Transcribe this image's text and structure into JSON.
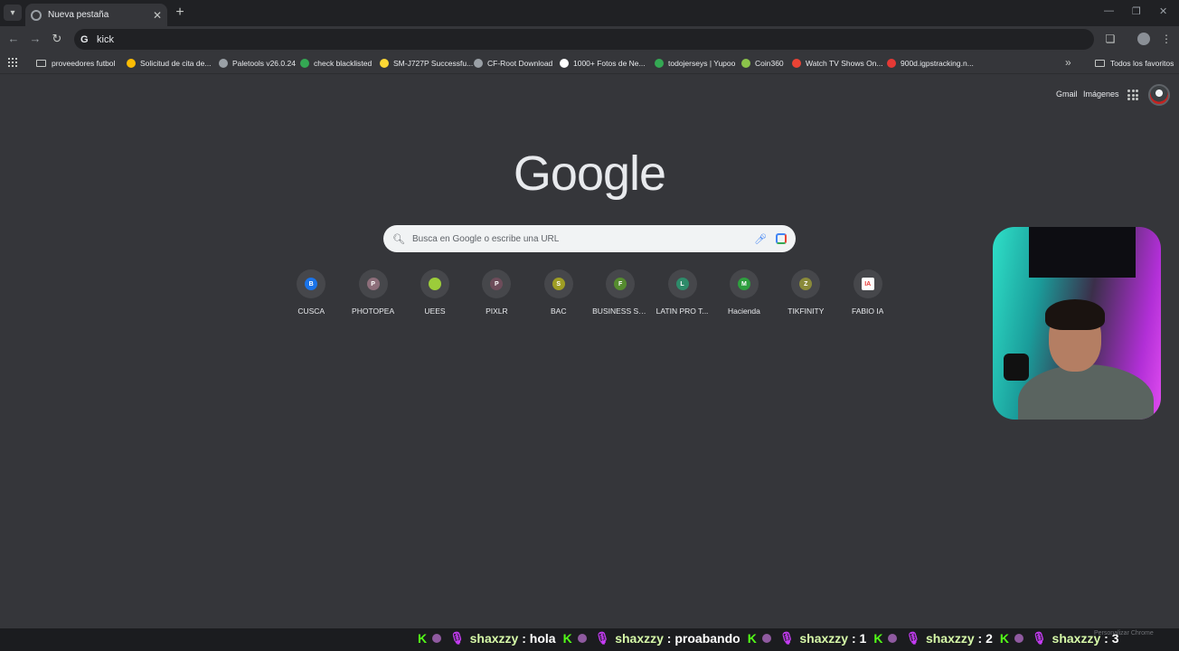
{
  "browser": {
    "tab_title": "Nueva pestaña",
    "omnibox_value": "kick",
    "colors": {
      "frame": "#202124",
      "toolbar": "#35363a",
      "page_bg": "#35363a"
    }
  },
  "bookmarks": [
    {
      "label": "proveedores futbol",
      "icon": "folder-icon",
      "color": ""
    },
    {
      "label": "Solicitud de cita de...",
      "icon": "bookmark-favicon",
      "color": "#fbbc04"
    },
    {
      "label": "Paletools v26.0.24",
      "icon": "globe-icon",
      "color": "#9aa0a6"
    },
    {
      "label": "check blacklisted",
      "icon": "bookmark-favicon",
      "color": "#34a853"
    },
    {
      "label": "SM-J727P Successfu...",
      "icon": "smiley-icon",
      "color": "#fdd835"
    },
    {
      "label": "CF-Root Download",
      "icon": "globe-icon",
      "color": "#9aa0a6"
    },
    {
      "label": "1000+ Fotos de Ne...",
      "icon": "bookmark-favicon",
      "color": "#ffffff"
    },
    {
      "label": "todojerseys | Yupoo",
      "icon": "bookmark-favicon",
      "color": "#34a853"
    },
    {
      "label": "Coin360",
      "icon": "bookmark-favicon",
      "color": "#8bc34a"
    },
    {
      "label": "Watch TV Shows On...",
      "icon": "bookmark-favicon",
      "color": "#ea4335"
    },
    {
      "label": "900d.igpstracking.n...",
      "icon": "bookmark-favicon",
      "color": "#e53935"
    }
  ],
  "bookmarks_all": "Todos los favoritos",
  "ntp": {
    "gmail": "Gmail",
    "images": "Imágenes",
    "logo": "Google",
    "search_placeholder": "Busca en Google o escribe una URL",
    "shortcuts": [
      {
        "label": "CUSCA",
        "letter": "B",
        "color": "#1a73e8"
      },
      {
        "label": "PHOTOPEA",
        "letter": "P",
        "color": "#8d6e7a"
      },
      {
        "label": "UEES",
        "letter": "",
        "color": "#9ccc3a"
      },
      {
        "label": "PIXLR",
        "letter": "P",
        "color": "#6d4c5a"
      },
      {
        "label": "BAC",
        "letter": "S",
        "color": "#9e9d24"
      },
      {
        "label": "BUSINESS SU...",
        "letter": "F",
        "color": "#558b2f"
      },
      {
        "label": "LATIN PRO T...",
        "letter": "L",
        "color": "#2e8b6a"
      },
      {
        "label": "Hacienda",
        "letter": "M",
        "color": "#2e9e3e"
      },
      {
        "label": "TIKFINITY",
        "letter": "Z",
        "color": "#8a8a3a"
      },
      {
        "label": "FABIO IA",
        "letter": "IA",
        "color": "#e53935"
      }
    ]
  },
  "chat": {
    "messages": [
      {
        "user": "shaxzzy",
        "text": "hola"
      },
      {
        "user": "shaxzzy",
        "text": "proabando"
      },
      {
        "user": "shaxzzy",
        "text": "1"
      },
      {
        "user": "shaxzzy",
        "text": "2"
      },
      {
        "user": "shaxzzy",
        "text": "3"
      }
    ],
    "badge": "K",
    "customize_label": "Personalizar Chrome",
    "colors": {
      "badge": "#53fc18",
      "mic": "#c63cf5"
    }
  }
}
